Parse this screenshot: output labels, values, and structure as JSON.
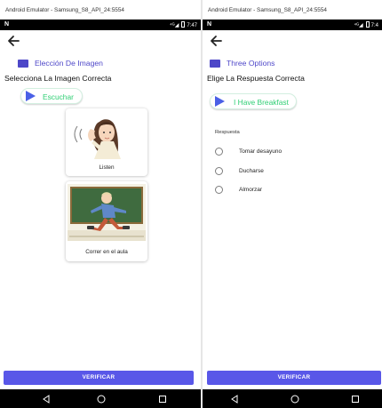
{
  "left": {
    "window_title": "Android Emulator - Samsung_S8_API_24:5554",
    "status": {
      "notification": "N",
      "signal": "⁴ᴳ◢",
      "time": "7:47"
    },
    "heading": "Elección De Imagen",
    "instruction": "Selecciona La Imagen Correcta",
    "audio_label": "Escuchar",
    "cards": [
      {
        "label": "Listen"
      },
      {
        "label": "Correr en el aula"
      }
    ],
    "verify_label": "VERIFICAR"
  },
  "right": {
    "window_title": "Android Emulator - Samsung_S8_API_24:5554",
    "status": {
      "notification": "N",
      "signal": "⁴ᴳ◢",
      "time": "7:4"
    },
    "heading": "Three Options",
    "instruction": "Elige La Respuesta Correcta",
    "audio_label": "I Have Breakfast",
    "radio_title": "Respuesta",
    "options": [
      "Tomar desayuno",
      "Ducharse",
      "Almorzar"
    ],
    "verify_label": "VERIFICAR"
  },
  "colors": {
    "accent": "#4f48c9",
    "play": "#4a60e6",
    "audio_text": "#2fcf74",
    "verify_bg": "#5957e8"
  },
  "icons": {
    "back": "arrow-left-icon",
    "heading": "flag-icon",
    "audio": "play-icon",
    "nav": [
      "back-triangle-icon",
      "home-circle-icon",
      "recents-square-icon"
    ]
  }
}
